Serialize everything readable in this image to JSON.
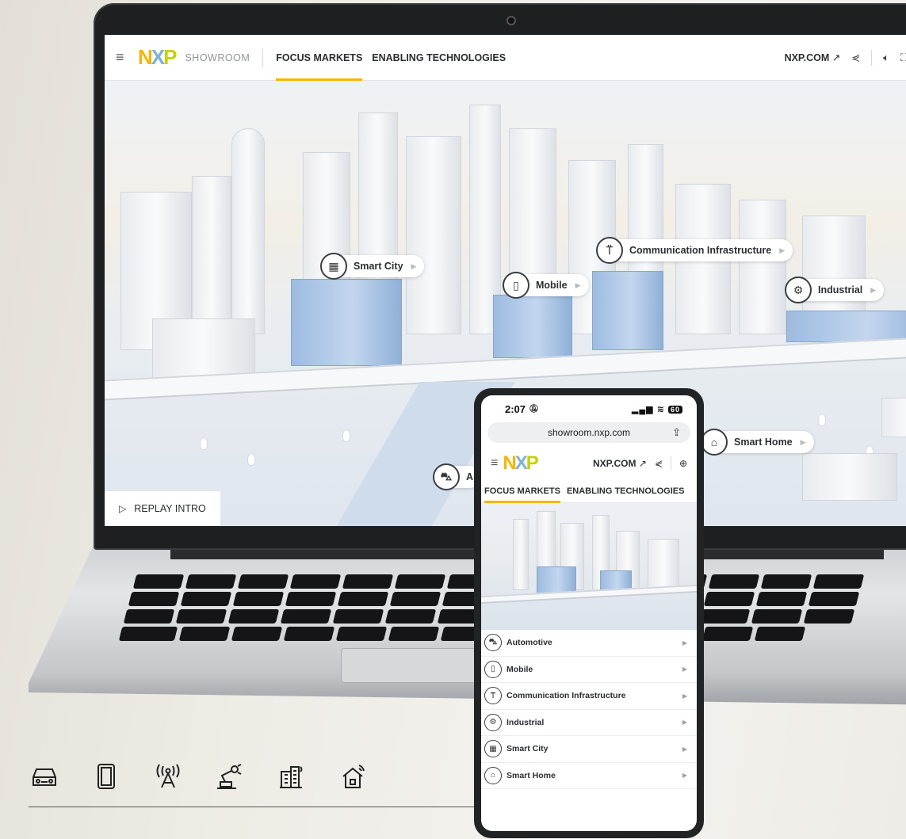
{
  "desktop": {
    "brand": "NXP",
    "showroom_label": "SHOWROOM",
    "nav": [
      {
        "label": "FOCUS MARKETS",
        "active": true
      },
      {
        "label": "ENABLING TECHNOLOGIES",
        "active": false
      }
    ],
    "external_link": "NXP.COM",
    "hotspots": {
      "smart_city": "Smart City",
      "communication": "Communication Infrastructure",
      "mobile": "Mobile",
      "industrial": "Industrial",
      "smart_home": "Smart Home",
      "automotive": "A"
    },
    "replay_label": "REPLAY INTRO"
  },
  "phone": {
    "time": "2:07",
    "battery": "60",
    "url": "showroom.nxp.com",
    "external_link": "NXP.COM",
    "tabs": [
      {
        "label": "FOCUS MARKETS",
        "active": true
      },
      {
        "label": "ENABLING TECHNOLOGIES",
        "active": false
      }
    ],
    "markets": [
      {
        "label": "Automotive",
        "icon": "car-icon"
      },
      {
        "label": "Mobile",
        "icon": "smartphone-icon"
      },
      {
        "label": "Communication Infrastructure",
        "icon": "antenna-icon"
      },
      {
        "label": "Industrial",
        "icon": "robot-arm-icon"
      },
      {
        "label": "Smart City",
        "icon": "city-building-icon"
      },
      {
        "label": "Smart Home",
        "icon": "smart-home-icon"
      }
    ]
  },
  "icon_strip": [
    "car-icon",
    "smartphone-icon",
    "antenna-icon",
    "robot-arm-icon",
    "city-building-icon",
    "smart-home-icon"
  ],
  "colors": {
    "accent": "#f9b500",
    "nxp_n": "#f9b500",
    "nxp_x": "#7bb1db",
    "nxp_p": "#c9d200",
    "building_blue": "#9dbbe0"
  }
}
